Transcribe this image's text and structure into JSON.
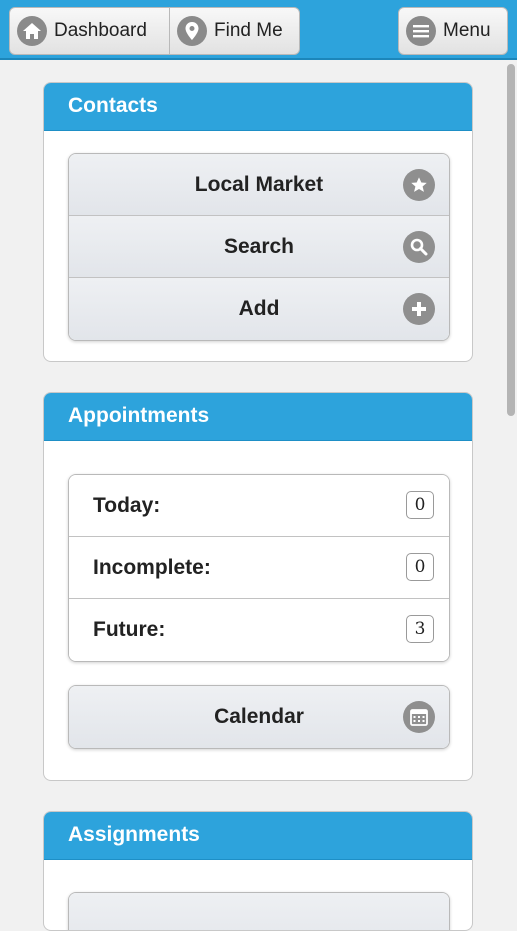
{
  "topbar": {
    "dashboard_label": "Dashboard",
    "findme_label": "Find Me",
    "menu_label": "Menu",
    "accent_color": "#2da3dc"
  },
  "contacts": {
    "title": "Contacts",
    "items": [
      {
        "label": "Local Market",
        "icon": "star-icon"
      },
      {
        "label": "Search",
        "icon": "search-icon"
      },
      {
        "label": "Add",
        "icon": "plus-icon"
      }
    ]
  },
  "appointments": {
    "title": "Appointments",
    "rows": [
      {
        "label": "Today:",
        "count": "0"
      },
      {
        "label": "Incomplete:",
        "count": "0"
      },
      {
        "label": "Future:",
        "count": "3"
      }
    ],
    "calendar_label": "Calendar",
    "calendar_icon": "calendar-icon"
  },
  "assignments": {
    "title": "Assignments"
  }
}
